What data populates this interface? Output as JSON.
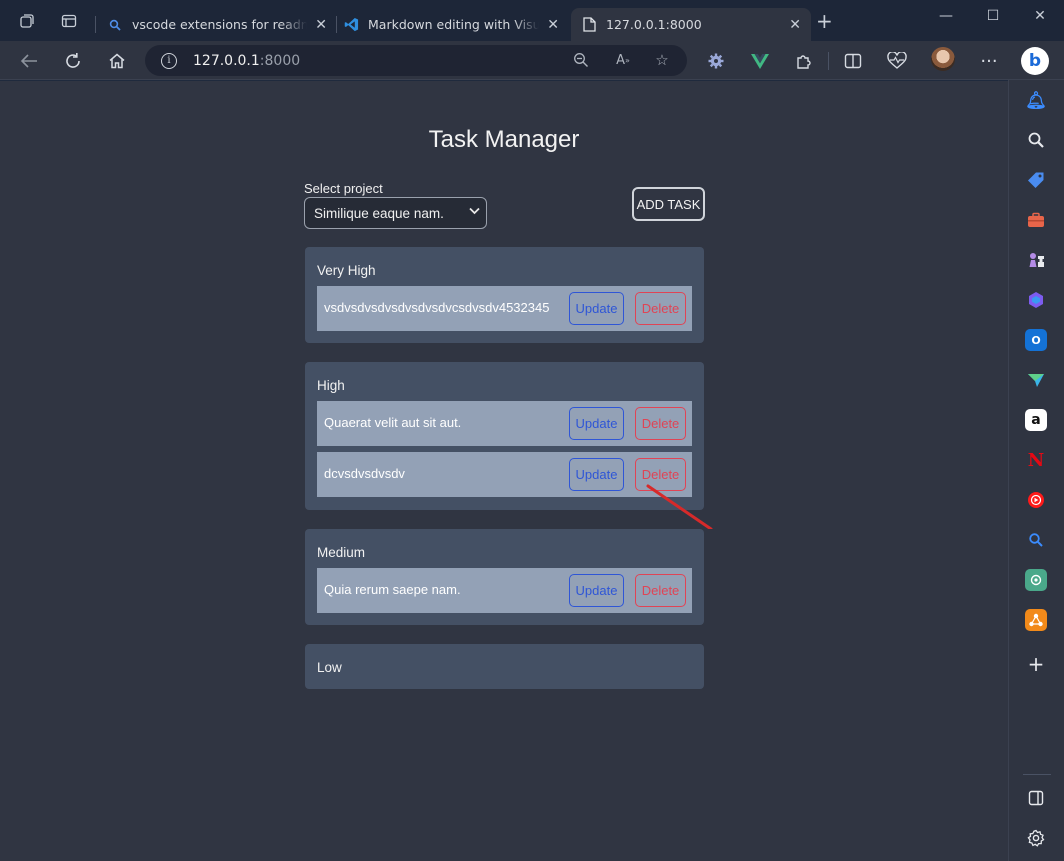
{
  "browser": {
    "tabs": [
      {
        "title": "vscode extensions for readme.M",
        "favicon": "search-favicon"
      },
      {
        "title": "Markdown editing with Visual Stu",
        "favicon": "vscode-favicon"
      },
      {
        "title": "127.0.0.1:8000",
        "favicon": "page-favicon",
        "active": true
      }
    ],
    "address": {
      "host": "127.0.0.1",
      "port": ":8000"
    }
  },
  "app": {
    "title": "Task Manager",
    "select_label": "Select project",
    "selected_project": "Similique eaque nam.",
    "add_task_label": "ADD TASK",
    "update_label": "Update",
    "delete_label": "Delete",
    "groups": [
      {
        "name": "Very High",
        "tasks": [
          "vsdvsdvsdvsdvsdvsdvcsdvsdv4532345"
        ]
      },
      {
        "name": "High",
        "tasks": [
          "Quaerat velit aut sit aut.",
          "dcvsdvsdvsdv"
        ]
      },
      {
        "name": "Medium",
        "tasks": [
          "Quia rerum saepe nam."
        ]
      },
      {
        "name": "Low",
        "tasks": []
      }
    ]
  },
  "colors": {
    "page_bg": "#303542",
    "group_bg": "#445064",
    "task_bg": "#93a1b6",
    "update": "#2f56d6",
    "delete": "#e04455",
    "annotation_arrow": "#d62a2a"
  }
}
